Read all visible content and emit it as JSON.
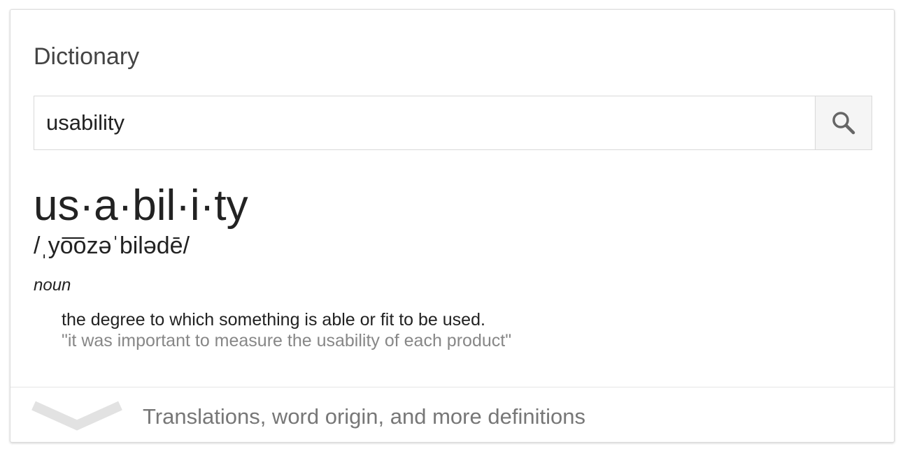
{
  "card": {
    "title": "Dictionary"
  },
  "search": {
    "value": "usability",
    "button_icon": "search-icon"
  },
  "entry": {
    "headword": "us·a·bil·i·ty",
    "phonetic": "/ˌyo͞ozəˈbilədē/",
    "part_of_speech": "noun",
    "definitions": [
      {
        "text": "the degree to which something is able or fit to be used.",
        "example": "\"it was important to measure the usability of each product\""
      }
    ]
  },
  "footer": {
    "expand_icon": "chevron-down-icon",
    "label": "Translations, word origin, and more definitions"
  },
  "colors": {
    "heading": "#444444",
    "text": "#222222",
    "example": "#878787",
    "footer_text": "#777777",
    "chevron": "#e0e0e0",
    "search_button_bg": "#f5f5f5"
  }
}
